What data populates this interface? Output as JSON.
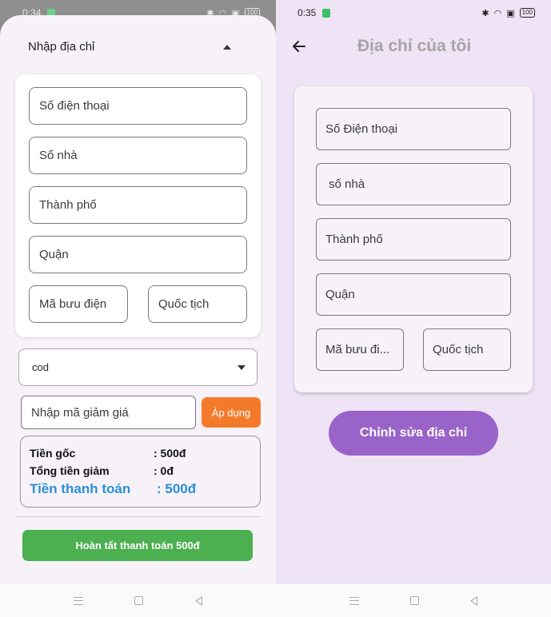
{
  "left": {
    "status": {
      "time": "0:34",
      "battery": "100"
    },
    "header": {
      "title": "Nhập địa chỉ"
    },
    "address_form": {
      "phone_placeholder": "Số điện thoại",
      "house_placeholder": "Số nhà",
      "city_placeholder": "Thành phố",
      "district_placeholder": "Quận",
      "postal_placeholder": "Mã bưu điện",
      "country_placeholder": "Quốc tịch"
    },
    "payment_method": {
      "selected": "cod"
    },
    "promo": {
      "placeholder": "Nhập mã giảm giá",
      "apply_label": "Áp dụng"
    },
    "summary": {
      "original_label": "Tiền gốc",
      "original_value": ": 500đ",
      "discount_label": "Tổng tiền giảm",
      "discount_value": ": 0đ",
      "total_label": "Tiền thanh toán",
      "total_value": ": 500đ"
    },
    "finish_label": "Hoàn tất thanh toán  500đ"
  },
  "right": {
    "status": {
      "time": "0:35",
      "battery": "100"
    },
    "title": "Địa chỉ của tôi",
    "address_form": {
      "phone": "Số Điện thoại",
      "house": "số nhà",
      "city": "Thành phố",
      "district": "Quận",
      "postal": "Mã bưu đi...",
      "country": "Quốc tịch"
    },
    "edit_label": "Chỉnh sửa địa chỉ"
  },
  "colors": {
    "apply": "#f47a2b",
    "finish": "#4caf50",
    "total": "#2b8fd6",
    "edit": "#9a63c9",
    "right_bg": "#efe3f6"
  }
}
